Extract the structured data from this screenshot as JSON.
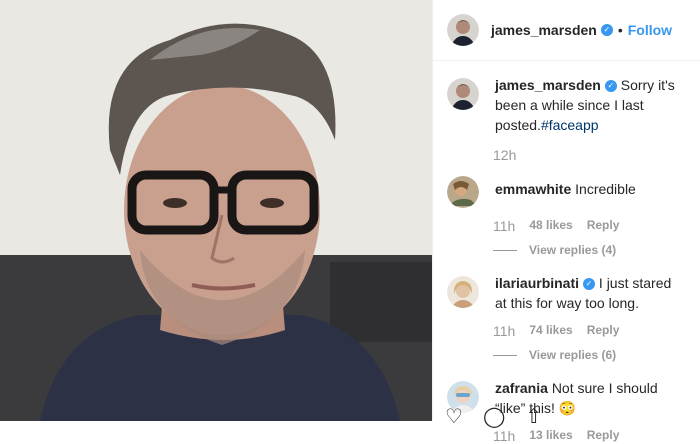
{
  "header": {
    "username": "james_marsden",
    "dot": "•",
    "follow_label": "Follow"
  },
  "caption": {
    "username": "james_marsden",
    "text": "Sorry it's been a while since I last posted.",
    "hashtag": "#faceapp",
    "time": "12h"
  },
  "comments": [
    {
      "username": "emmawhite",
      "text": "Incredible",
      "time": "11h",
      "likes": "48 likes",
      "reply": "Reply",
      "view_replies": "View replies (4)",
      "verified": false
    },
    {
      "username": "ilariaurbinati",
      "text": "I just stared at this for way too long.",
      "time": "11h",
      "likes": "74 likes",
      "reply": "Reply",
      "view_replies": "View replies (6)",
      "verified": true
    },
    {
      "username": "zafrania",
      "text": "Not sure I should “like” this! 😳",
      "time": "11h",
      "likes": "13 likes",
      "reply": "Reply",
      "verified": false
    }
  ],
  "icons": {
    "heart": "heart-icon",
    "comment": "comment-icon",
    "share": "share-icon"
  },
  "colors": {
    "link": "#3897f0",
    "hashtag": "#003569",
    "meta": "#999999",
    "text": "#262626"
  }
}
